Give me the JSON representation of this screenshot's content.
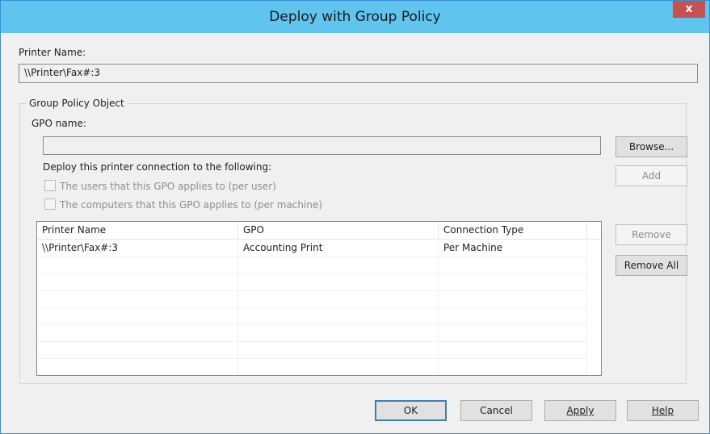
{
  "window": {
    "title": "Deploy with Group Policy",
    "close_glyph": "x",
    "accent_color": "#5fc4ee"
  },
  "printer": {
    "label": "Printer Name:",
    "value": "\\\\Printer\\Fax#:3"
  },
  "gpo_group": {
    "title": "Group Policy Object",
    "gpo_name_label": "GPO name:",
    "gpo_name_value": "",
    "browse_label": "Browse...",
    "deploy_label": "Deploy this printer connection to the following:",
    "add_label": "Add",
    "checkboxes": [
      {
        "label": "The users that this GPO applies to (per user)",
        "checked": false,
        "enabled": false
      },
      {
        "label": "The computers that this GPO applies to (per machine)",
        "checked": false,
        "enabled": false
      }
    ],
    "remove_label": "Remove",
    "remove_all_label": "Remove All"
  },
  "table": {
    "columns": [
      "Printer Name",
      "GPO",
      "Connection Type"
    ],
    "rows": [
      [
        "\\\\Printer\\Fax#:3",
        "Accounting Print",
        "Per Machine"
      ]
    ]
  },
  "footer": {
    "ok": "OK",
    "cancel": "Cancel",
    "apply": "Apply",
    "help": "Help"
  }
}
